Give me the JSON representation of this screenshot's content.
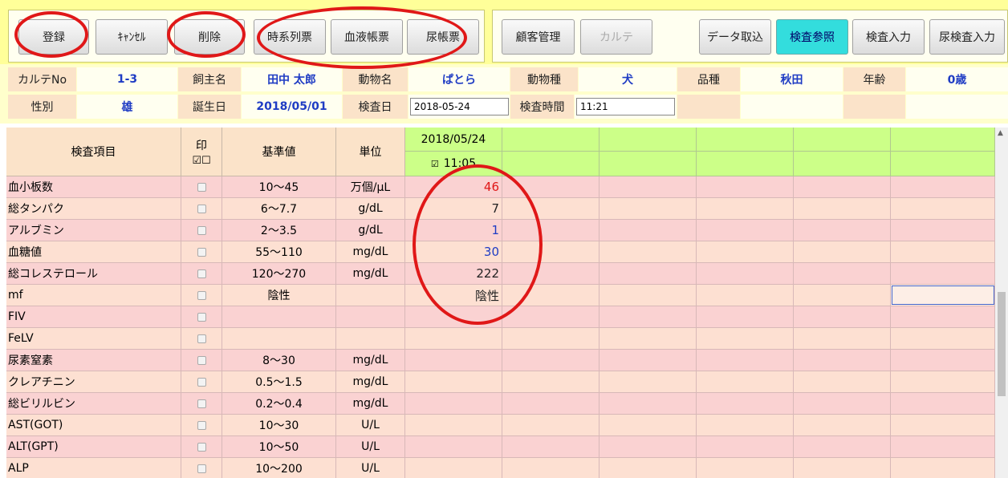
{
  "toolbar": {
    "register": "登録",
    "cancel": "ｷｬﾝｾﾙ",
    "delete": "削除",
    "timeseries": "時系列票",
    "blood_ledger": "血液帳票",
    "urine_ledger": "尿帳票",
    "customer_mgmt": "顧客管理",
    "karte": "カルテ",
    "data_import": "データ取込",
    "exam_ref": "検査参照",
    "exam_input": "検査入力",
    "urine_input": "尿検査入力"
  },
  "patient": {
    "karte_no_label": "カルテNo",
    "karte_no": "1-3",
    "owner_label": "飼主名",
    "owner": "田中 太郎",
    "animal_name_label": "動物名",
    "animal_name": "ぱとら",
    "species_label": "動物種",
    "species": "犬",
    "breed_label": "品種",
    "breed": "秋田",
    "age_label": "年齢",
    "age": "0歳",
    "sex_label": "性別",
    "sex": "雄",
    "birth_label": "誕生日",
    "birth": "2018/05/01",
    "exam_date_label": "検査日",
    "exam_date": "2018-05-24",
    "exam_time_label": "検査時間",
    "exam_time": "11:21"
  },
  "grid": {
    "col_item": "検査項目",
    "col_print": "印",
    "print_all": "☑",
    "print_none": "☐",
    "col_ref": "基準値",
    "col_unit": "単位",
    "date_col": {
      "date": "2018/05/24",
      "check": "☑",
      "time": "11:05"
    },
    "rows": [
      {
        "name": "血小板数",
        "ref": "10～45",
        "unit": "万個/μL",
        "value": "46",
        "color": "#e01818"
      },
      {
        "name": "総タンパク",
        "ref": "6～7.7",
        "unit": "g/dL",
        "value": "7",
        "color": "#222222"
      },
      {
        "name": "アルブミン",
        "ref": "2～3.5",
        "unit": "g/dL",
        "value": "1",
        "color": "#1f3cc4"
      },
      {
        "name": "血糖値",
        "ref": "55～110",
        "unit": "mg/dL",
        "value": "30",
        "color": "#1f3cc4"
      },
      {
        "name": "総コレステロール",
        "ref": "120～270",
        "unit": "mg/dL",
        "value": "222",
        "color": "#222222"
      },
      {
        "name": "mf",
        "ref": "陰性",
        "unit": "",
        "value": "陰性",
        "color": "#222222"
      },
      {
        "name": "FIV",
        "ref": "",
        "unit": "",
        "value": "",
        "color": "#222222"
      },
      {
        "name": "FeLV",
        "ref": "",
        "unit": "",
        "value": "",
        "color": "#222222"
      },
      {
        "name": "尿素窒素",
        "ref": "8～30",
        "unit": "mg/dL",
        "value": "",
        "color": "#222222"
      },
      {
        "name": "クレアチニン",
        "ref": "0.5～1.5",
        "unit": "mg/dL",
        "value": "",
        "color": "#222222"
      },
      {
        "name": "総ビリルビン",
        "ref": "0.2～0.4",
        "unit": "mg/dL",
        "value": "",
        "color": "#222222"
      },
      {
        "name": "AST(GOT)",
        "ref": "10～30",
        "unit": "U/L",
        "value": "",
        "color": "#222222"
      },
      {
        "name": "ALT(GPT)",
        "ref": "10～50",
        "unit": "U/L",
        "value": "",
        "color": "#222222"
      },
      {
        "name": "ALP",
        "ref": "10～200",
        "unit": "U/L",
        "value": "",
        "color": "#222222"
      }
    ]
  }
}
